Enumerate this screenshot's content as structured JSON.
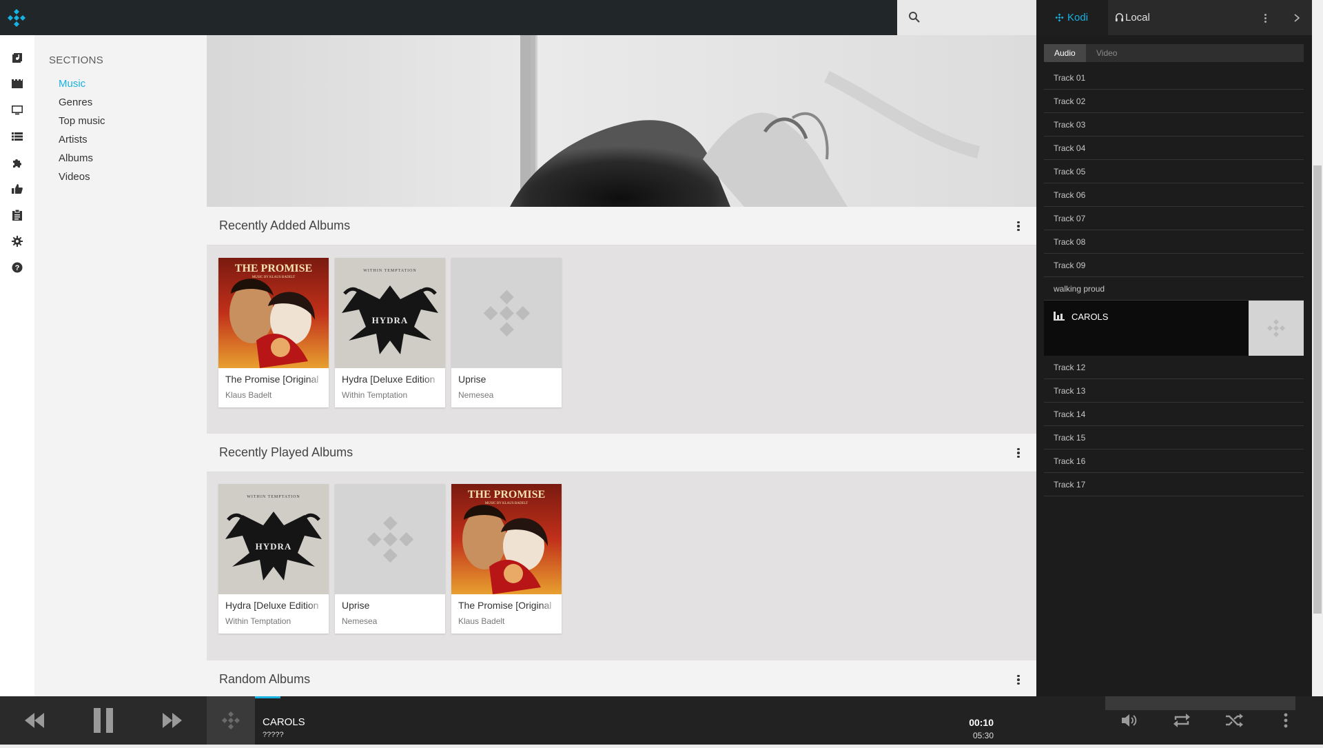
{
  "topbar": {
    "search_placeholder": ""
  },
  "nav_icons": [
    "music-library-icon",
    "movies-icon",
    "tv-icon",
    "playlist-icon",
    "addons-icon",
    "thumbs-up-icon",
    "clipboard-icon",
    "settings-icon",
    "help-icon"
  ],
  "sections": {
    "title": "SECTIONS",
    "items": [
      {
        "label": "Music"
      },
      {
        "label": "Genres"
      },
      {
        "label": "Top music"
      },
      {
        "label": "Artists"
      },
      {
        "label": "Albums"
      },
      {
        "label": "Videos"
      }
    ]
  },
  "main": {
    "recently_added": {
      "title": "Recently Added Albums",
      "albums": [
        {
          "title": "The Promise [Original",
          "artist": "Klaus Badelt",
          "art": "promise"
        },
        {
          "title": "Hydra [Deluxe Edition",
          "artist": "Within Temptation",
          "art": "hydra"
        },
        {
          "title": "Uprise",
          "artist": "Nemesea",
          "art": "placeholder"
        }
      ]
    },
    "recently_played": {
      "title": "Recently Played Albums",
      "albums": [
        {
          "title": "Hydra [Deluxe Edition",
          "artist": "Within Temptation",
          "art": "hydra"
        },
        {
          "title": "Uprise",
          "artist": "Nemesea",
          "art": "placeholder"
        },
        {
          "title": "The Promise [Original",
          "artist": "Klaus Badelt",
          "art": "promise"
        }
      ]
    },
    "random": {
      "title": "Random Albums"
    }
  },
  "album_art_text": {
    "promise_title": "THE PROMISE",
    "promise_sub": "MUSIC BY KLAUS BADELT",
    "hydra_band": "WITHIN TEMPTATION",
    "hydra_title": "HYDRA"
  },
  "playlist": {
    "tabs": {
      "kodi": "Kodi",
      "local": "Local"
    },
    "subtabs": {
      "audio": "Audio",
      "video": "Video"
    },
    "tracks": [
      "Track 01",
      "Track 02",
      "Track 03",
      "Track 04",
      "Track 05",
      "Track 06",
      "Track 07",
      "Track 08",
      "Track 09",
      "walking proud",
      "CAROLS",
      "Track 12",
      "Track 13",
      "Track 14",
      "Track 15",
      "Track 16",
      "Track 17"
    ],
    "playing_index": 10
  },
  "player": {
    "title": "CAROLS",
    "subtitle": "?????",
    "time_current": "00:10",
    "time_total": "05:30",
    "progress_fraction": 0.03
  },
  "colors": {
    "accent": "#17b2e2",
    "topbar": "#212628",
    "panel_dark": "#1c1c1c"
  }
}
